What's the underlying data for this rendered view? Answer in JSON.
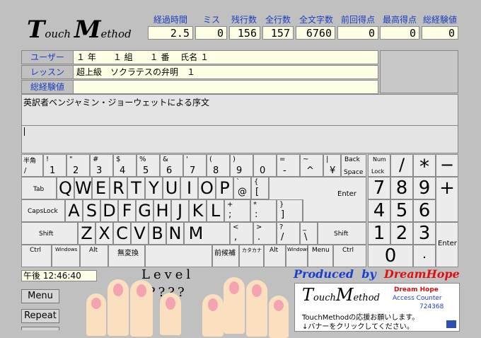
{
  "logo": {
    "t_big": "T",
    "t_small": "ouch ",
    "m_big": "M",
    "m_small": "ethod"
  },
  "stats": [
    {
      "label": "経過時間",
      "value": "2.5"
    },
    {
      "label": "ミス",
      "value": "0"
    },
    {
      "label": "残行数",
      "value": "156"
    },
    {
      "label": "全行数",
      "value": "157"
    },
    {
      "label": "全文字数",
      "value": "6760"
    },
    {
      "label": "前回得点",
      "value": "0"
    },
    {
      "label": "最高得点",
      "value": "0"
    },
    {
      "label": "総経験値",
      "value": "0"
    }
  ],
  "info": {
    "user_label": "ユーザー",
    "user_value": "１ 年　　１ 組　　１ 番　 氏名 １",
    "lesson_label": "レッスン",
    "lesson_value": "超上級　ソクラテスの弁明　１",
    "exp_label": "総経験値",
    "exp_value": ""
  },
  "text": {
    "line1": "英訳者ベンジャミン・ジョーウェットによる序文"
  },
  "keyboard": {
    "row1": [
      {
        "top": "半角",
        "bot": "/"
      },
      {
        "top": "!",
        "main": "1"
      },
      {
        "top": "\"",
        "main": "2"
      },
      {
        "top": "#",
        "main": "3"
      },
      {
        "top": "$",
        "main": "4"
      },
      {
        "top": "%",
        "main": "5"
      },
      {
        "top": "&",
        "main": "6"
      },
      {
        "top": "'",
        "main": "7"
      },
      {
        "top": "(",
        "main": "8"
      },
      {
        "top": ")",
        "main": "9"
      },
      {
        "top": "",
        "main": "0"
      },
      {
        "top": "=",
        "main": "-"
      },
      {
        "top": "~",
        "main": "^"
      },
      {
        "top": "|",
        "main": "¥"
      },
      {
        "top": "Back",
        "bot": "Space"
      }
    ],
    "row2": [
      "Q",
      "W",
      "E",
      "R",
      "T",
      "Y",
      "U",
      "I",
      "O",
      "P"
    ],
    "row2_extra": [
      {
        "top": "`",
        "main": "@"
      },
      {
        "top": "{",
        "main": "["
      }
    ],
    "tab": "Tab",
    "enter": "Enter",
    "row3": [
      "A",
      "S",
      "D",
      "F",
      "G",
      "H",
      "J",
      "K",
      "L"
    ],
    "row3_extra": [
      {
        "top": "+",
        "main": ";"
      },
      {
        "top": "*",
        "main": ":"
      },
      {
        "top": "}",
        "main": "]"
      }
    ],
    "capslock": "CapsLock",
    "row4": [
      "Z",
      "X",
      "C",
      "V",
      "B",
      "N",
      "M"
    ],
    "row4_extra": [
      {
        "top": "<",
        "main": ","
      },
      {
        "top": ">",
        "main": "."
      },
      {
        "top": "?",
        "main": "/"
      },
      {
        "top": "_",
        "main": "\\"
      }
    ],
    "shift": "Shift",
    "row5": [
      {
        "label": "Ctrl"
      },
      {
        "label": "Windows"
      },
      {
        "label": "Alt"
      },
      {
        "label": "無変換"
      },
      {
        "label": ""
      },
      {
        "label": "前候補"
      },
      {
        "label": "カタカナ"
      },
      {
        "label": "Alt"
      },
      {
        "label": "Windows"
      },
      {
        "label": "Menu"
      },
      {
        "label": "Ctrl"
      }
    ],
    "numpad": {
      "numlock_top": "Num",
      "numlock_bot": "Lock",
      "slash": "/",
      "star": "*",
      "minus": "−",
      "seven": "7",
      "eight": "8",
      "nine": "9",
      "plus": "+",
      "four": "4",
      "five": "5",
      "six": "6",
      "one": "1",
      "two": "2",
      "three": "3",
      "enter": "Enter",
      "zero": "0",
      "dot": "."
    }
  },
  "clock": "午後 12:46:40",
  "level_label": "Level",
  "level_value": "????",
  "buttons": {
    "menu": "Menu",
    "repeat": "Repeat"
  },
  "produced": {
    "by": "Produced  by  ",
    "name": "DreamHope"
  },
  "banner": {
    "t_big": "T",
    "t_small": "ouch",
    "m_big": "M",
    "m_small": "ethod",
    "dreamhope": "Dream Hope",
    "access": "Access Counter",
    "count": "724368",
    "line1": "TouchMethodの応援お願いします。",
    "line2": "↓バナーをクリックしてください。"
  }
}
